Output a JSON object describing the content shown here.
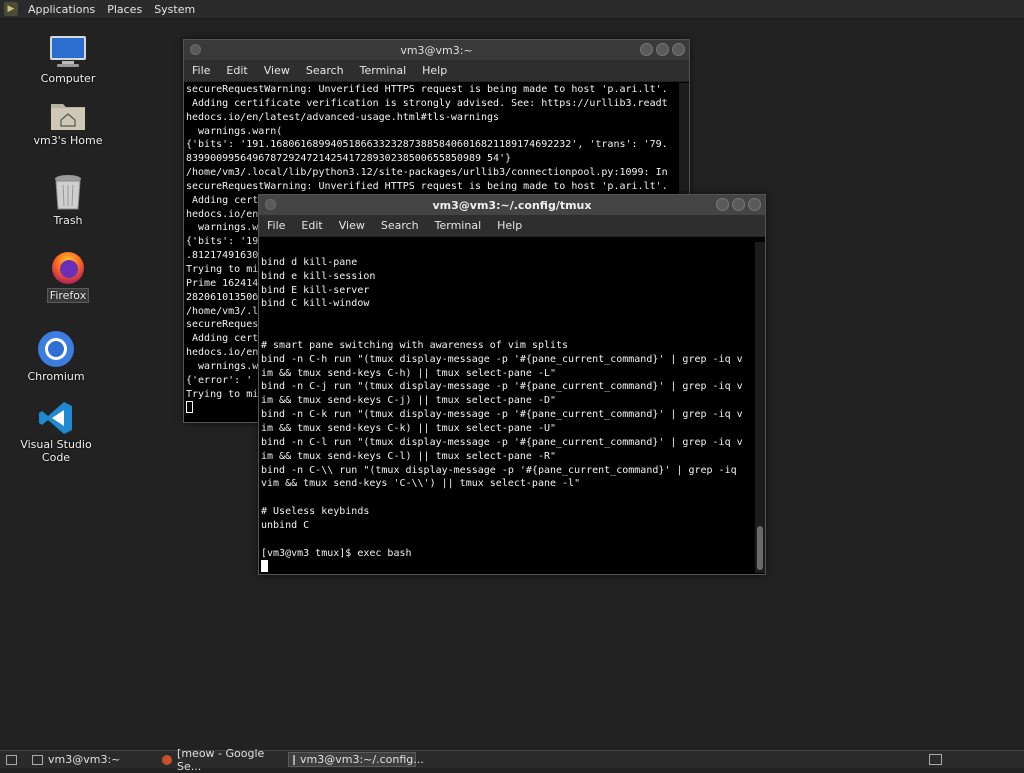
{
  "top_panel": {
    "menus": [
      "Applications",
      "Places",
      "System"
    ]
  },
  "desktop_icons": {
    "computer": "Computer",
    "home": "vm3's Home",
    "trash": "Trash",
    "firefox": "Firefox",
    "chromium": "Chromium",
    "vscode": "Visual Studio Code"
  },
  "back_window": {
    "title": "vm3@vm3:~",
    "menu": [
      "File",
      "Edit",
      "View",
      "Search",
      "Terminal",
      "Help"
    ],
    "lines": [
      "secureRequestWarning: Unverified HTTPS request is being made to host 'p.ari.lt'.",
      " Adding certificate verification is strongly advised. See: https://urllib3.readt",
      "hedocs.io/en/latest/advanced-usage.html#tls-warnings",
      "  warnings.warn(",
      "{'bits': '191.16806168994051866332328738858406016821189174692232', 'trans': '79.",
      "8399009956496787292472142541728930238500655850989 54'}",
      "/home/vm3/.local/lib/python3.12/site-packages/urllib3/connectionpool.py:1099: In",
      "secureRequestWarning: Unverified HTTPS request is being made to host 'p.ari.lt'.",
      " Adding cert",
      "hedocs.io/en",
      "  warnings.w",
      "{'bits': '19",
      ".81217491630",
      "Trying to mi",
      "Prime 162414",
      "28206101350б",
      "/home/vm3/.l",
      "secureReques",
      " Adding cert",
      "hedocs.io/en",
      "  warnings.w",
      "{'error': '",
      "Trying to mi"
    ]
  },
  "front_window": {
    "title": "vm3@vm3:~/.config/tmux",
    "menu": [
      "File",
      "Edit",
      "View",
      "Search",
      "Terminal",
      "Help"
    ],
    "lines": [
      "",
      "bind d kill-pane",
      "bind e kill-session",
      "bind E kill-server",
      "bind C kill-window",
      "",
      "",
      "# smart pane switching with awareness of vim splits",
      "bind -n C-h run \"(tmux display-message -p '#{pane_current_command}' | grep -iq v",
      "im && tmux send-keys C-h) || tmux select-pane -L\"",
      "bind -n C-j run \"(tmux display-message -p '#{pane_current_command}' | grep -iq v",
      "im && tmux send-keys C-j) || tmux select-pane -D\"",
      "bind -n C-k run \"(tmux display-message -p '#{pane_current_command}' | grep -iq v",
      "im && tmux send-keys C-k) || tmux select-pane -U\"",
      "bind -n C-l run \"(tmux display-message -p '#{pane_current_command}' | grep -iq v",
      "im && tmux send-keys C-l) || tmux select-pane -R\"",
      "bind -n C-\\\\ run \"(tmux display-message -p '#{pane_current_command}' | grep -iq",
      "vim && tmux send-keys 'C-\\\\') || tmux select-pane -l\"",
      "",
      "# Useless keybinds",
      "unbind C",
      "",
      "[vm3@vm3 tmux]$ exec bash"
    ]
  },
  "taskbar": {
    "tasks": [
      "vm3@vm3:~",
      "[meow - Google Se...",
      "vm3@vm3:~/.config..."
    ]
  }
}
